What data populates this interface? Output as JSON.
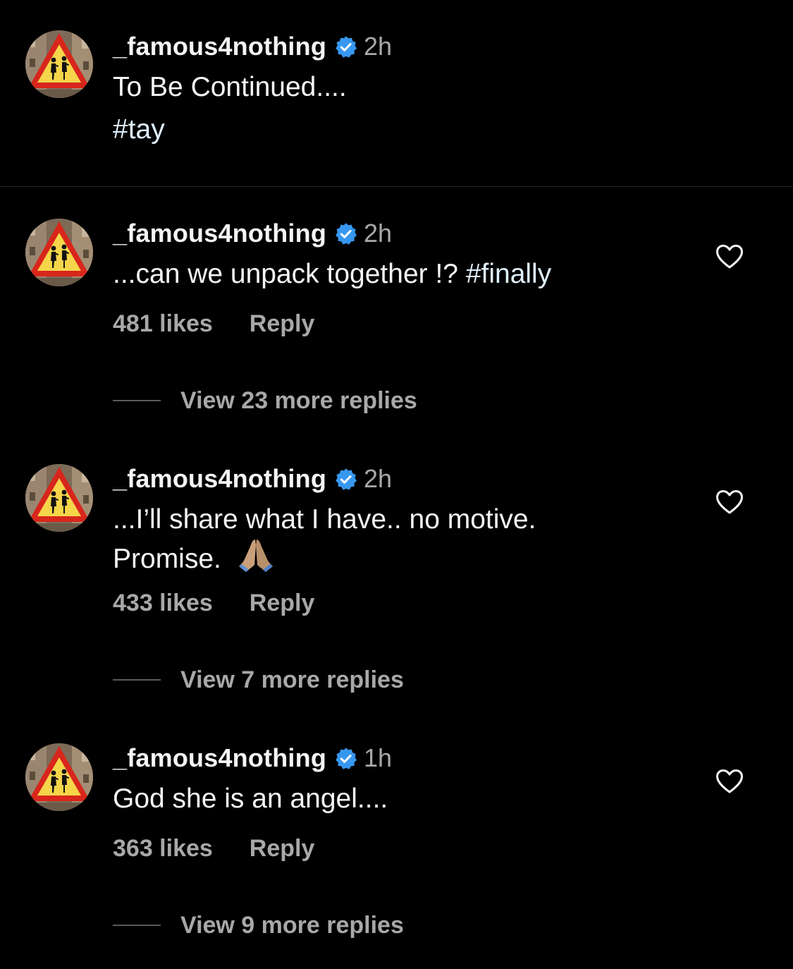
{
  "caption": {
    "username": "_famous4nothing",
    "time": "2h",
    "text": "To Be Continued....",
    "hashtag": "#tay"
  },
  "comments": [
    {
      "username": "_famous4nothing",
      "time": "2h",
      "text": "...can we unpack together !? ",
      "hashtag": "#finally",
      "likes": "481 likes",
      "reply_label": "Reply",
      "view_replies": "View 23 more replies"
    },
    {
      "username": "_famous4nothing",
      "time": "2h",
      "text": "...I’ll share what I have.. no motive. Promise. ",
      "emoji": "folded-hands",
      "likes": "433 likes",
      "reply_label": "Reply",
      "view_replies": "View 7 more replies"
    },
    {
      "username": "_famous4nothing",
      "time": "1h",
      "text": "God she is an angel....",
      "likes": "363 likes",
      "reply_label": "Reply",
      "view_replies": "View 9 more replies"
    }
  ],
  "icons": {
    "verified": "verified-badge-icon",
    "heart": "heart-outline-icon",
    "avatar": "warning-sign-avatar"
  },
  "colors": {
    "background": "#000000",
    "text": "#f5f5f5",
    "secondary": "#a8a8a8",
    "verified": "#3797f0",
    "divider": "#262626"
  }
}
